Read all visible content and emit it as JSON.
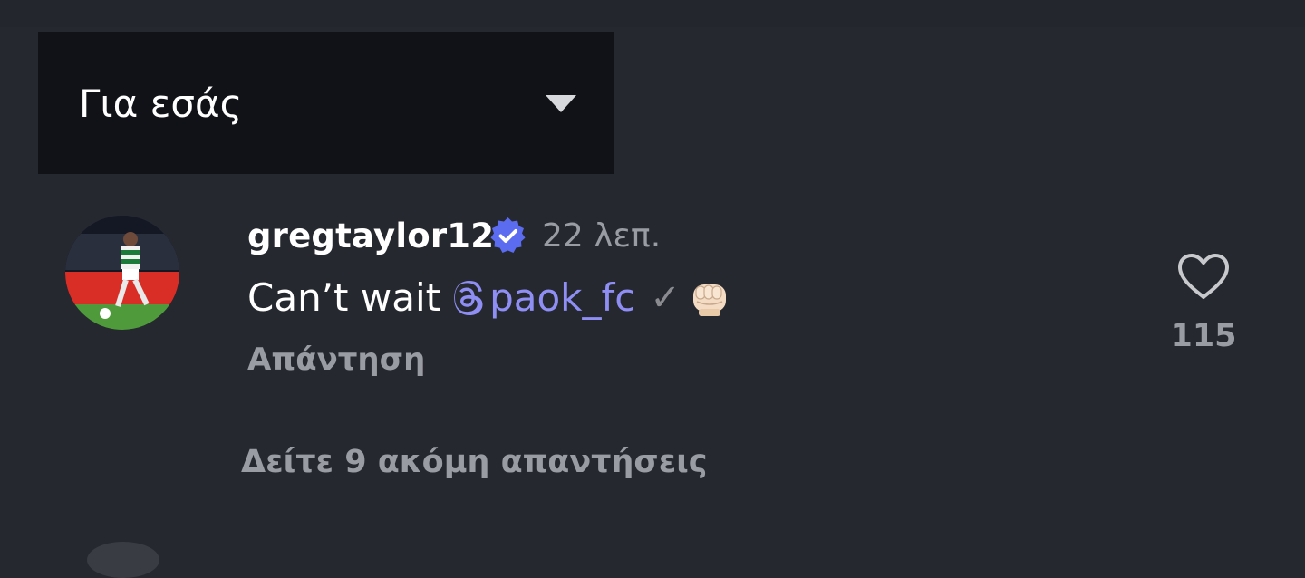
{
  "filter": {
    "label": "Για εσάς"
  },
  "comment": {
    "username": "gregtaylor12",
    "timestamp": "22 λεπ.",
    "text": "Can’t wait",
    "mention": "paok_fc",
    "check": "✓",
    "reply_label": "Απάντηση",
    "likes": "115"
  },
  "thread": {
    "more_replies_label": "Δείτε 9 ακόμη απαντήσεις"
  },
  "colors": {
    "background": "#262830",
    "dropdown_bg": "#101217",
    "mention": "#8e8ef4",
    "verified": "#5b6cf0",
    "muted_text": "#9a9ca3"
  },
  "icons": {
    "dropdown": "chevron-down-icon",
    "verified": "verified-badge-icon",
    "mention": "threads-logo-icon",
    "like": "heart-icon",
    "emoji": "fist-emoji-icon"
  }
}
